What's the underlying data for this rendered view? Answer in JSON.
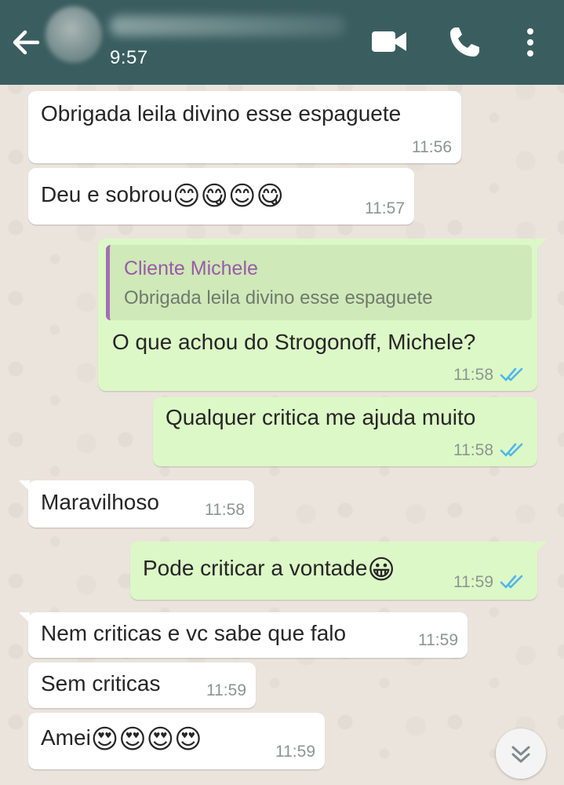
{
  "header": {
    "status_time": "9:57",
    "icons": [
      "back-arrow-icon",
      "video-call-icon",
      "phone-call-icon",
      "more-options-icon"
    ],
    "color": "#3a5e60"
  },
  "messages": [
    {
      "dir": "in",
      "text": "Obrigada leila divino esse espaguete",
      "time": "11:56"
    },
    {
      "dir": "in",
      "text": "Deu e sobrou",
      "emojis": "😊😋😊😋",
      "time": "11:57"
    },
    {
      "dir": "out",
      "quote_author": "Cliente Michele",
      "quote_text": "Obrigada leila divino esse espaguete",
      "text": "O que achou do Strogonoff, Michele?",
      "time": "11:58",
      "status": "read"
    },
    {
      "dir": "out",
      "text": "Qualquer critica me ajuda muito",
      "time": "11:58",
      "status": "read"
    },
    {
      "dir": "in",
      "text": "Maravilhoso",
      "time": "11:58"
    },
    {
      "dir": "out",
      "text": "Pode criticar a vontade",
      "emojis": "😀",
      "time": "11:59",
      "status": "read"
    },
    {
      "dir": "in",
      "text": "Nem criticas e vc sabe que falo",
      "time": "11:59"
    },
    {
      "dir": "in",
      "text": "Sem criticas",
      "time": "11:59"
    },
    {
      "dir": "in",
      "text": "Amei",
      "emojis": "😍😍😍😍",
      "time": "11:59"
    }
  ],
  "colors": {
    "incoming_bubble": "#ffffff",
    "outgoing_bubble": "#dcf8c6",
    "read_ticks": "#4fb6ec",
    "quote_author": "#9a5aa9"
  },
  "scroll_button_icon": "double-chevron-down-icon"
}
